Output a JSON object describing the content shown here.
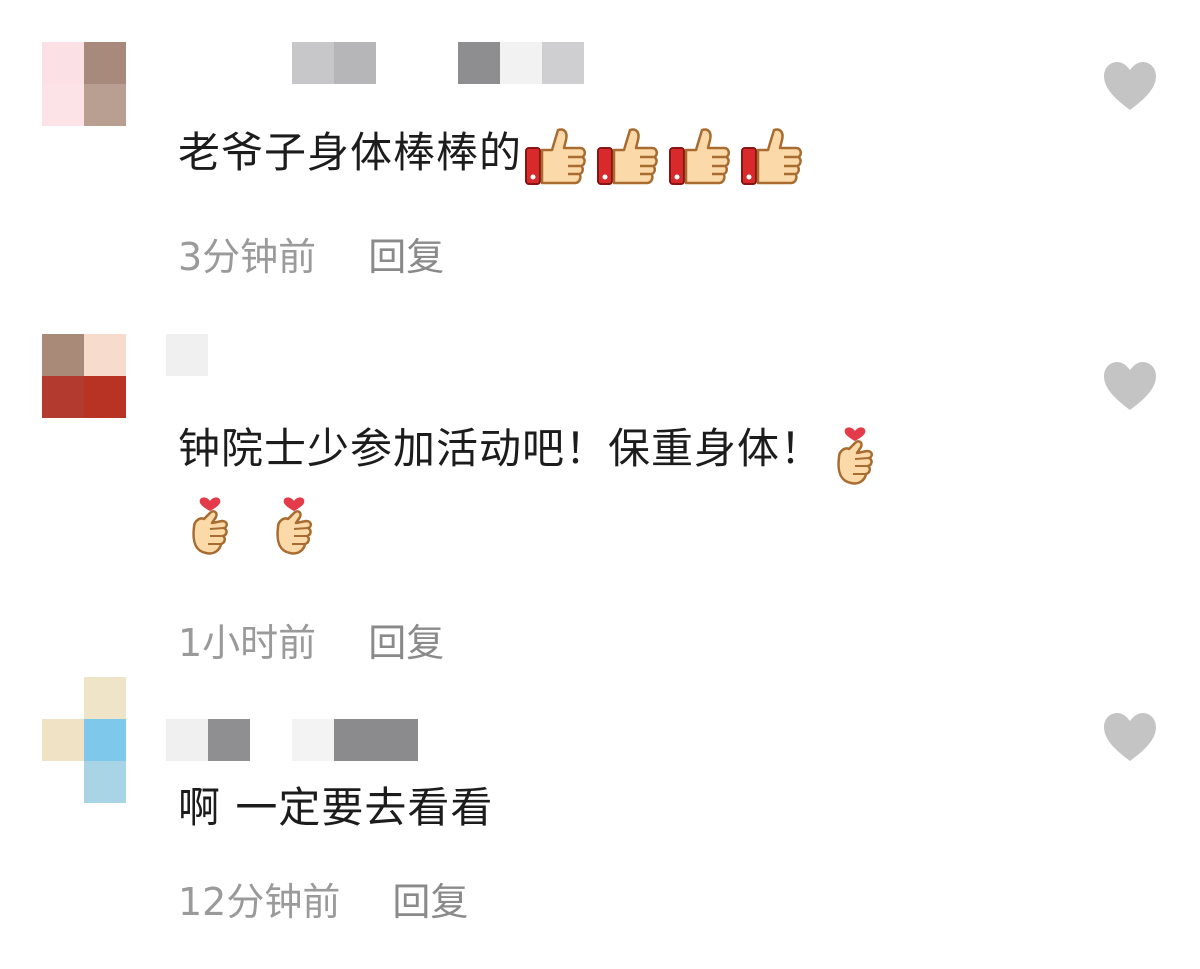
{
  "comments": [
    {
      "text": "老爷子身体棒棒的",
      "emoji_name": "thumbs-up-icon",
      "emoji_count": 4,
      "time": "3分钟前",
      "reply_label": "回复"
    },
    {
      "text": "钟院士少参加活动吧！保重身体！",
      "emoji_name": "finger-heart-icon",
      "emoji_count": 3,
      "time": "1小时前",
      "reply_label": "回复"
    },
    {
      "text": "啊 一定要去看看",
      "emoji_name": "",
      "emoji_count": 0,
      "time": "12分钟前",
      "reply_label": "回复"
    }
  ],
  "colors": {
    "like_heart": "#c4c4c4",
    "meta_text": "#9a9a9a",
    "body_text": "#1c1c1c"
  }
}
